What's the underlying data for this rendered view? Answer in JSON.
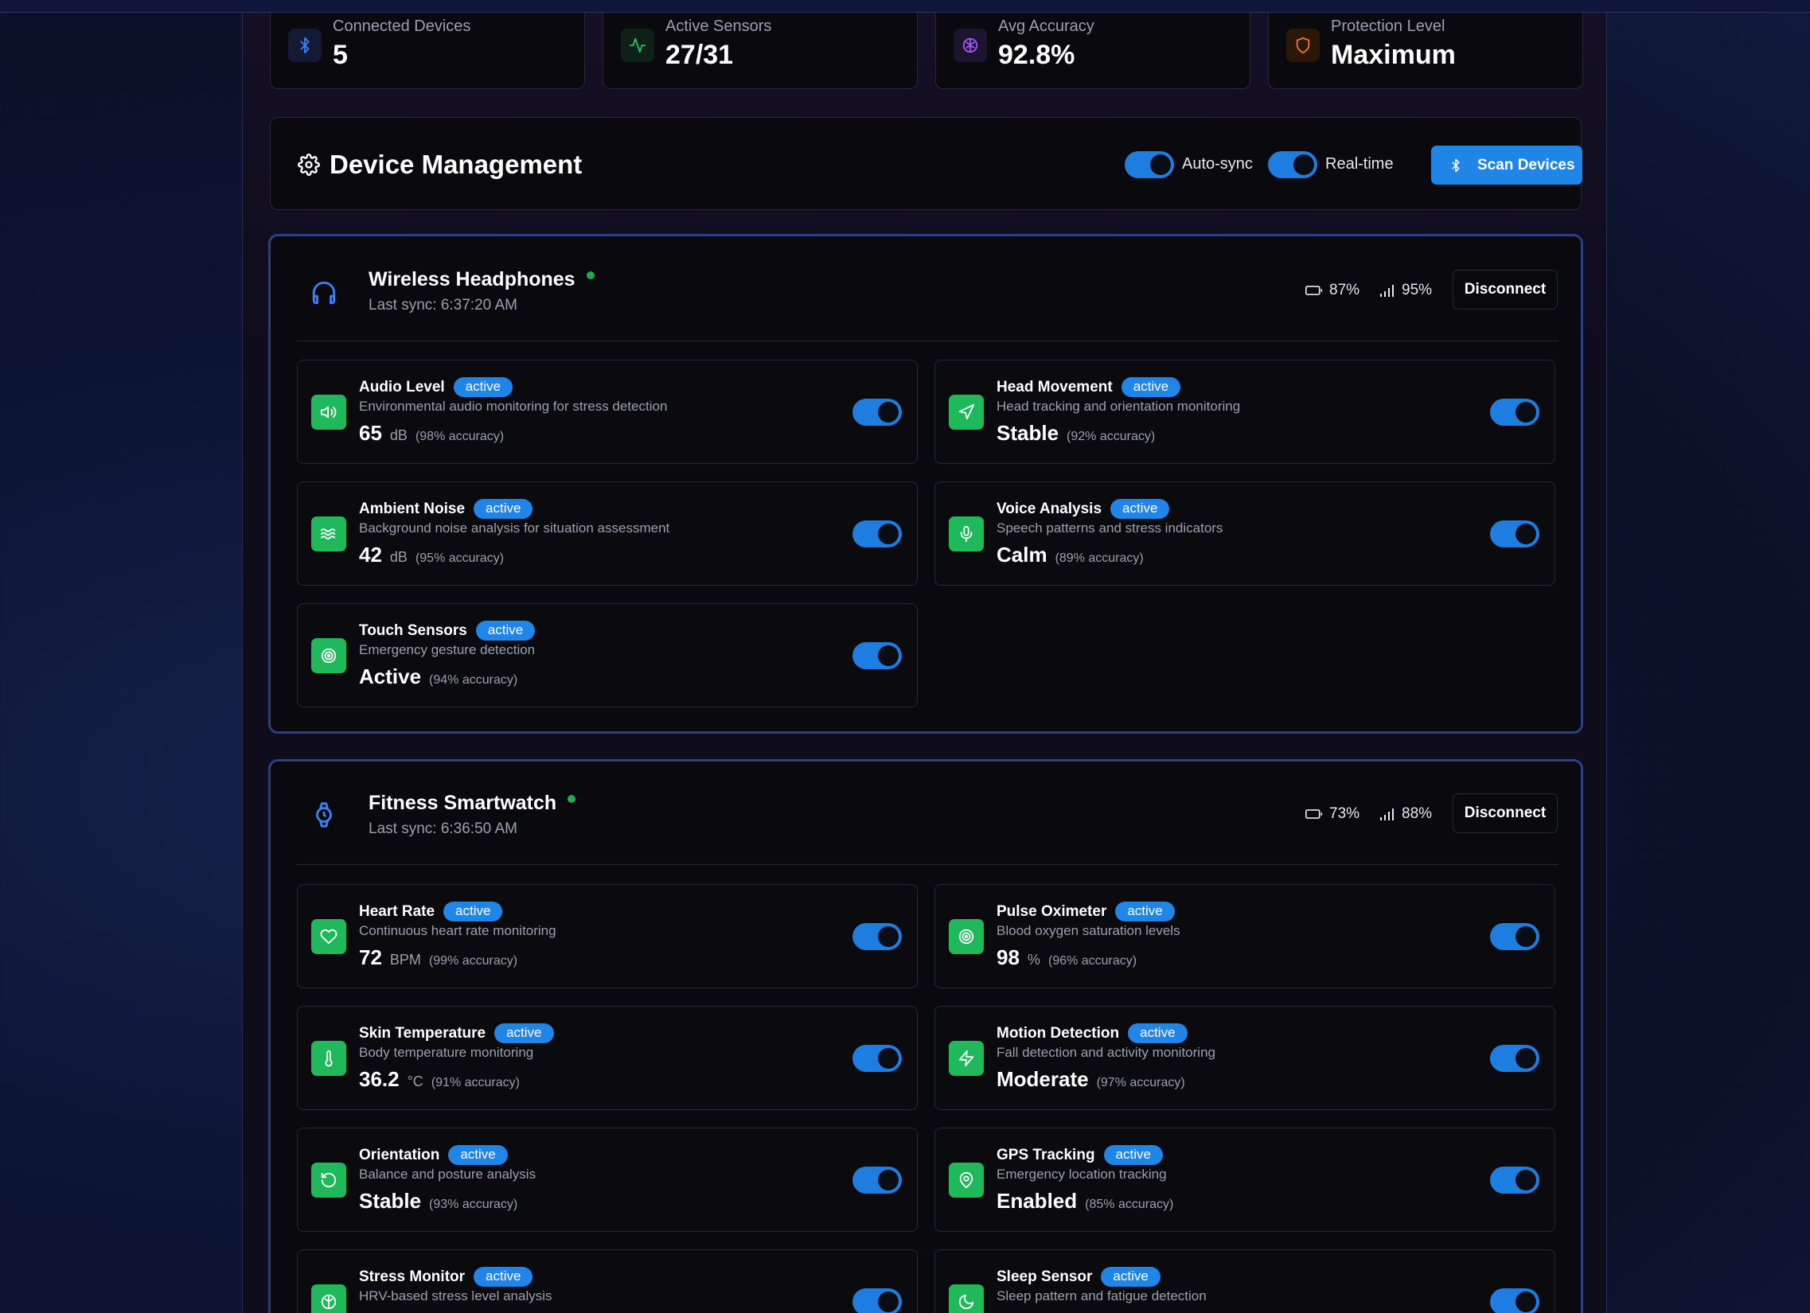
{
  "stats": [
    {
      "label": "Connected Devices",
      "value": "5",
      "icon": "bluetooth-icon",
      "color": "#3b82f6"
    },
    {
      "label": "Active Sensors",
      "value": "27/31",
      "icon": "activity-icon",
      "color": "#22c55e"
    },
    {
      "label": "Avg Accuracy",
      "value": "92.8%",
      "icon": "brain-icon",
      "color": "#a855f7"
    },
    {
      "label": "Protection Level",
      "value": "Maximum",
      "icon": "shield-icon",
      "color": "#f97316"
    }
  ],
  "management": {
    "title": "Device Management",
    "auto_sync_label": "Auto-sync",
    "realtime_label": "Real-time",
    "scan_label": "Scan Devices"
  },
  "devices": [
    {
      "name": "Wireless Headphones",
      "last_sync": "Last sync: 6:37:20 AM",
      "battery": "87%",
      "signal": "95%",
      "disconnect_label": "Disconnect",
      "sensors": [
        {
          "name": "Audio Level",
          "status": "active",
          "desc": "Environmental audio monitoring for stress detection",
          "value": "65",
          "unit": "dB",
          "accuracy": "(98% accuracy)",
          "icon": "volume-icon"
        },
        {
          "name": "Head Movement",
          "status": "active",
          "desc": "Head tracking and orientation monitoring",
          "value": "Stable",
          "unit": "",
          "accuracy": "(92% accuracy)",
          "icon": "navigation-icon"
        },
        {
          "name": "Ambient Noise",
          "status": "active",
          "desc": "Background noise analysis for situation assessment",
          "value": "42",
          "unit": "dB",
          "accuracy": "(95% accuracy)",
          "icon": "waves-icon"
        },
        {
          "name": "Voice Analysis",
          "status": "active",
          "desc": "Speech patterns and stress indicators",
          "value": "Calm",
          "unit": "",
          "accuracy": "(89% accuracy)",
          "icon": "microphone-icon"
        },
        {
          "name": "Touch Sensors",
          "status": "active",
          "desc": "Emergency gesture detection",
          "value": "Active",
          "unit": "",
          "accuracy": "(94% accuracy)",
          "icon": "target-icon"
        }
      ]
    },
    {
      "name": "Fitness Smartwatch",
      "last_sync": "Last sync: 6:36:50 AM",
      "battery": "73%",
      "signal": "88%",
      "disconnect_label": "Disconnect",
      "sensors": [
        {
          "name": "Heart Rate",
          "status": "active",
          "desc": "Continuous heart rate monitoring",
          "value": "72",
          "unit": "BPM",
          "accuracy": "(99% accuracy)",
          "icon": "heart-icon"
        },
        {
          "name": "Pulse Oximeter",
          "status": "active",
          "desc": "Blood oxygen saturation levels",
          "value": "98",
          "unit": "%",
          "accuracy": "(96% accuracy)",
          "icon": "target-icon"
        },
        {
          "name": "Skin Temperature",
          "status": "active",
          "desc": "Body temperature monitoring",
          "value": "36.2",
          "unit": "°C",
          "accuracy": "(91% accuracy)",
          "icon": "thermometer-icon"
        },
        {
          "name": "Motion Detection",
          "status": "active",
          "desc": "Fall detection and activity monitoring",
          "value": "Moderate",
          "unit": "",
          "accuracy": "(97% accuracy)",
          "icon": "zap-icon"
        },
        {
          "name": "Orientation",
          "status": "active",
          "desc": "Balance and posture analysis",
          "value": "Stable",
          "unit": "",
          "accuracy": "(93% accuracy)",
          "icon": "rotate-icon"
        },
        {
          "name": "GPS Tracking",
          "status": "active",
          "desc": "Emergency location tracking",
          "value": "Enabled",
          "unit": "",
          "accuracy": "(85% accuracy)",
          "icon": "map-pin-icon"
        },
        {
          "name": "Stress Monitor",
          "status": "active",
          "desc": "HRV-based stress level analysis",
          "value": "",
          "unit": "",
          "accuracy": "",
          "icon": "brain-icon"
        },
        {
          "name": "Sleep Sensor",
          "status": "active",
          "desc": "Sleep pattern and fatigue detection",
          "value": "",
          "unit": "",
          "accuracy": "",
          "icon": "moon-icon"
        }
      ]
    }
  ]
}
